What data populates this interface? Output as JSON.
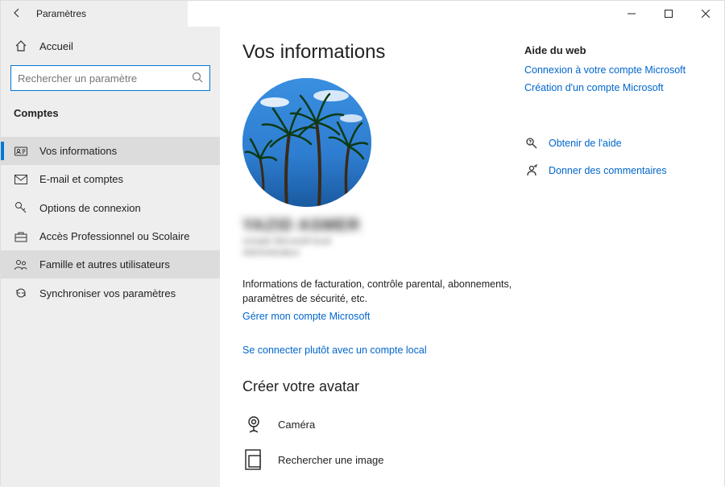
{
  "window": {
    "title": "Paramètres"
  },
  "sidebar": {
    "home": "Accueil",
    "search_placeholder": "Rechercher un paramètre",
    "section": "Comptes",
    "items": [
      {
        "label": "Vos informations"
      },
      {
        "label": "E-mail et comptes"
      },
      {
        "label": "Options de connexion"
      },
      {
        "label": "Accès Professionnel ou Scolaire"
      },
      {
        "label": "Famille et autres utilisateurs"
      },
      {
        "label": "Synchroniser vos paramètres"
      }
    ]
  },
  "main": {
    "heading": "Vos informations",
    "username_blur": "YAZID ASMER",
    "sub1_blur": "compte Microsoft local",
    "sub2_blur": "Administrateur",
    "description": "Informations de facturation, contrôle parental, abonnements, paramètres de sécurité, etc.",
    "manage_link": "Gérer mon compte Microsoft",
    "local_link": "Se connecter plutôt avec un compte local",
    "avatar_heading": "Créer votre avatar",
    "camera": "Caméra",
    "browse": "Rechercher une image"
  },
  "aside": {
    "help_head": "Aide du web",
    "link1": "Connexion à votre compte Microsoft",
    "link2": "Création d'un compte Microsoft",
    "help_link": "Obtenir de l'aide",
    "feedback_link": "Donner des commentaires"
  }
}
